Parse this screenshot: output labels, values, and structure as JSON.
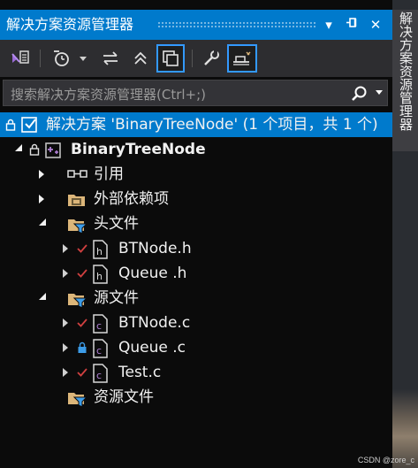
{
  "panel": {
    "title": "解决方案资源管理器",
    "dropdown_glyph": "▾",
    "pin_glyph": "⊣",
    "close_glyph": "✕"
  },
  "search": {
    "placeholder": "搜索解决方案资源管理器(Ctrl+;)"
  },
  "tree": {
    "solution": "解决方案 'BinaryTreeNode' (1 个项目，共 1 个)",
    "project": "BinaryTreeNode",
    "references": "引用",
    "external_deps": "外部依赖项",
    "header_files": "头文件",
    "header_items": [
      "BTNode.h",
      "Queue .h"
    ],
    "source_files": "源文件",
    "source_items": [
      "BTNode.c",
      "Queue .c",
      "Test.c"
    ],
    "resource_files": "资源文件"
  },
  "side_tab": {
    "label": "解决方案资源管理器"
  },
  "watermark": "CSDN @zore_c",
  "colors": {
    "accent": "#007acc",
    "panel_bg": "#0b0b0b",
    "toolbar_bg": "#2d2d30",
    "checkmark_red": "#d04040",
    "folder_tan": "#dcb67a",
    "filter_blue": "#3c9ce8"
  }
}
